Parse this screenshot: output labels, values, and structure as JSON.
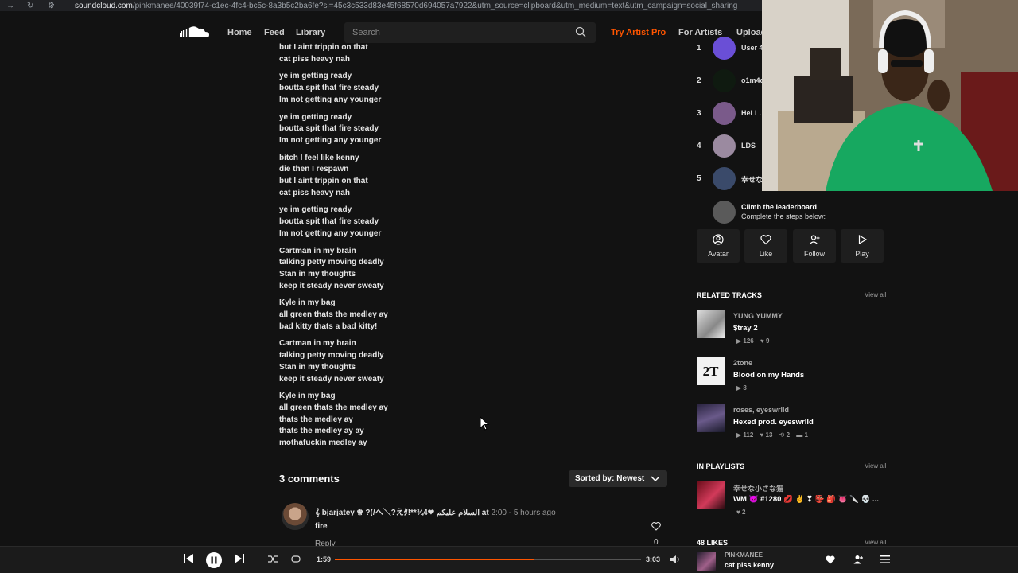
{
  "browser": {
    "url_host": "soundcloud.com",
    "url_rest": "/pinkmanee/40039f74-c1ec-4fc4-bc5c-8a3b5c2ba6fe?si=45c3c533d83e45f68570d694057a7922&utm_source=clipboard&utm_medium=text&utm_campaign=social_sharing"
  },
  "nav": {
    "home": "Home",
    "feed": "Feed",
    "library": "Library",
    "search_placeholder": "Search",
    "try_pro": "Try Artist Pro",
    "for_artists": "For Artists",
    "upload": "Upload"
  },
  "lyrics": [
    [
      "but I aint trippin on that",
      "cat piss heavy nah"
    ],
    [
      "ye im getting ready",
      "boutta spit that fire steady",
      "Im not getting any younger"
    ],
    [
      "ye im getting ready",
      "boutta spit that fire steady",
      "Im not getting any younger"
    ],
    [
      "bitch I feel like kenny",
      "die then I respawn",
      "but I aint trippin on that",
      "cat piss heavy nah"
    ],
    [
      "ye im getting ready",
      "boutta spit that fire steady",
      "Im not getting any younger"
    ],
    [
      "Cartman in my brain",
      "talking petty moving deadly",
      "Stan in my thoughts",
      "keep it steady never sweaty"
    ],
    [
      "Kyle in my bag",
      "all green thats the medley ay",
      "bad kitty thats a bad kitty!"
    ],
    [
      "Cartman in my brain",
      "talking petty moving deadly",
      "Stan in my thoughts",
      "keep it steady never sweaty"
    ],
    [
      "Kyle in my bag",
      "all green thats the medley ay",
      "thats the medley ay",
      "thats the medley ay ay",
      "mothafuckin medley ay"
    ]
  ],
  "comments": {
    "title": "3 comments",
    "sort_label": "Sorted by: Newest",
    "item": {
      "author": "𝄞 bjarjatey ♛ ?(/へ＼?えﾀ!**¾4❤ السلام عليكم at",
      "at_time": "2:00",
      "ago": "- 5 hours ago",
      "body": "fire",
      "reply": "Reply",
      "likes": "0"
    }
  },
  "leaderboard": [
    {
      "rank": "1",
      "name": "User 4",
      "color": "#6a4fd6"
    },
    {
      "rank": "2",
      "name": "o1m4c",
      "color": "#0f1a10"
    },
    {
      "rank": "3",
      "name": "HeLL.",
      "color": "#7a5a8a"
    },
    {
      "rank": "4",
      "name": "LDS",
      "color": "#9b8aa0"
    },
    {
      "rank": "5",
      "name": "幸せな",
      "color": "#3a4a6a"
    }
  ],
  "climb": {
    "title": "Climb the leaderboard",
    "subtitle": "Complete the steps below:",
    "actions": [
      "Avatar",
      "Like",
      "Follow",
      "Play"
    ]
  },
  "related": {
    "title": "RELATED TRACKS",
    "view_all": "View all",
    "tracks": [
      {
        "artist": "YUNG YUMMY",
        "title": "$tray 2",
        "plays": "126",
        "likes": "9"
      },
      {
        "artist": "2tone",
        "title": "Blood on my Hands",
        "plays": "8"
      },
      {
        "artist": "roses, eyeswrlld",
        "title": "Hexed prod. eyeswrlld",
        "plays": "112",
        "likes": "13",
        "reposts": "2",
        "comments": "1"
      }
    ]
  },
  "playlists": {
    "title": "IN PLAYLISTS",
    "view_all": "View all",
    "item": {
      "artist": "幸せな小さな猫",
      "title": "WM 👿 #1280 💋 ✌ ❣ 👺 🎒 👅 🔪 💀 ...",
      "likes": "2"
    }
  },
  "likes_section": {
    "title": "48 LIKES",
    "view_all": "View all"
  },
  "player": {
    "elapsed": "1:59",
    "duration": "3:03",
    "progress": 0.65,
    "artist": "PINKMANEE",
    "title": "cat piss kenny"
  },
  "colors": {
    "accent": "#ff5500",
    "bg": "#121212"
  }
}
